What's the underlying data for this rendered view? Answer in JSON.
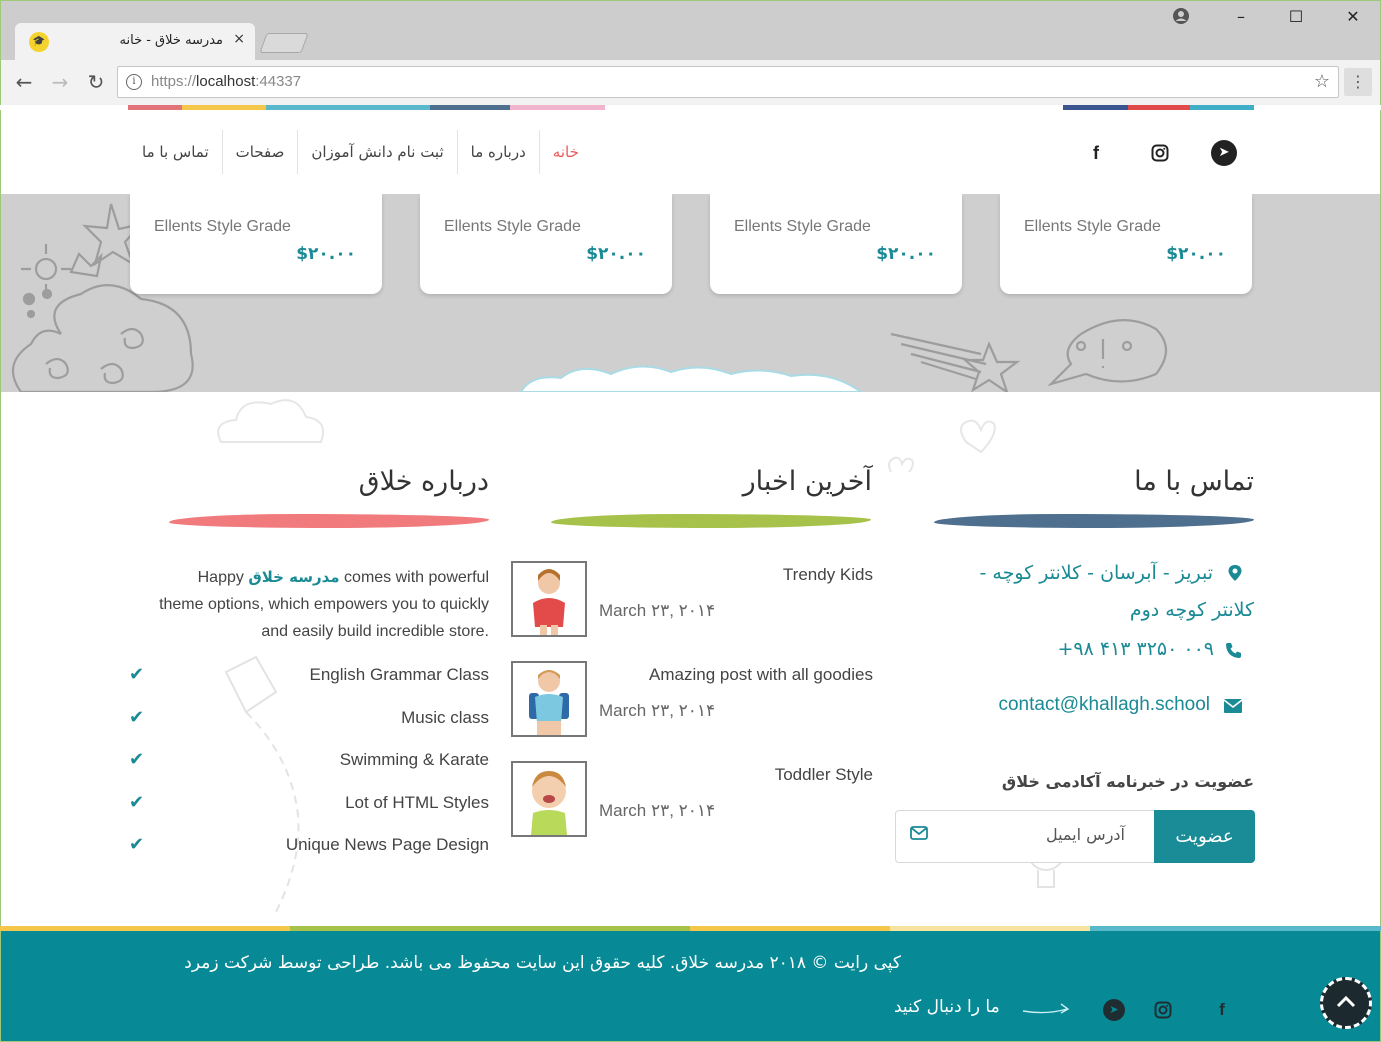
{
  "browser": {
    "tab_title": "مدرسه خلاق - خانه",
    "tab_close": "×",
    "url_scheme": "https://",
    "url_host": "localhost",
    "url_port": ":44337",
    "window_controls": [
      "–",
      "☐",
      "✕"
    ]
  },
  "header": {
    "nav": [
      {
        "label": "خانه",
        "active": true
      },
      {
        "label": "درباره ما",
        "active": false
      },
      {
        "label": "ثبت نام دانش آموزان",
        "active": false
      },
      {
        "label": "صفحات",
        "active": false
      },
      {
        "label": "تماس با ما",
        "active": false
      }
    ],
    "social_icons": [
      "facebook-icon",
      "instagram-icon",
      "telegram-icon"
    ],
    "colors": [
      "#e07478",
      "#f4c64a",
      "#5ab8cb",
      "#4e6f8e",
      "#f0b4cc"
    ]
  },
  "products": [
    {
      "name": "Ellents Style Grade",
      "price": "$۲۰.۰۰"
    },
    {
      "name": "Ellents Style Grade",
      "price": "$۲۰.۰۰"
    },
    {
      "name": "Ellents Style Grade",
      "price": "$۲۰.۰۰"
    },
    {
      "name": "Ellents Style Grade",
      "price": "$۲۰.۰۰"
    }
  ],
  "contact": {
    "title": "تماس با ما",
    "address_line1": "تبریز - آبرسان - کلانتر کوچه -",
    "address_line2": "کلانتر کوچه دوم",
    "phone": "+۹۸ ۴۱۳ ۳۲۵۰ ۰۰۹",
    "email": "contact@khallagh.school",
    "newsletter_title": "عضویت در خبرنامه آکادمی خلاق",
    "email_placeholder": "آدرس ایمیل",
    "subscribe_label": "عضویت",
    "brush_color": "#4e6f8e"
  },
  "news": {
    "title": "آخرین اخبار",
    "brush_color": "#a6c24a",
    "posts": [
      {
        "title": "Trendy Kids",
        "date": "March ۲۳, ۲۰۱۴"
      },
      {
        "title": "Amazing post with all goodies",
        "date": "March ۲۳, ۲۰۱۴"
      },
      {
        "title": "Toddler Style",
        "date": "March ۲۳, ۲۰۱۴"
      }
    ]
  },
  "about": {
    "title": "درباره خلاق",
    "brush_color": "#f07a7c",
    "intro_prefix": "Happy",
    "brand": "مدرسه خلاق",
    "intro_rest": "comes with powerful theme options, which empowers you to quickly and easily build incredible store.",
    "features": [
      "English Grammar Class",
      "Music class",
      "Swimming & Karate",
      "Lot of HTML Styles",
      "Unique News Page Design"
    ]
  },
  "footer": {
    "copyright": "کپی رایت © ۲۰۱۸ مدرسه خلاق. کلیه حقوق این سایت محفوظ می باشد. طراحی توسط شرکت زمرد",
    "follow_label": "ما را دنبال کنید",
    "bg_color": "#088a96",
    "strip_colors": [
      "#f4c64a",
      "#a6c24a",
      "#f4c64a",
      "#f7e3a0",
      "#5ab8cb"
    ]
  }
}
